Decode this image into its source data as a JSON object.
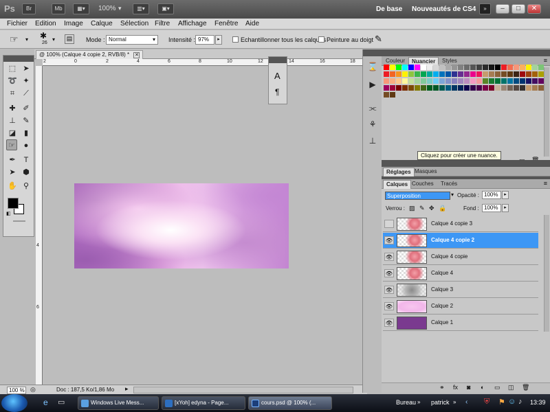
{
  "titlebar": {
    "app_logo": "Ps",
    "btn_br": "Br",
    "btn_mb": "Mb",
    "zoom": "100%",
    "workspace_basic": "De base",
    "workspace_cs4": "Nouveautés de CS4"
  },
  "menu": [
    "Fichier",
    "Edition",
    "Image",
    "Calque",
    "Sélection",
    "Filtre",
    "Affichage",
    "Fenêtre",
    "Aide"
  ],
  "options": {
    "brush_size": "26",
    "mode_label": "Mode :",
    "mode_value": "Normal",
    "intensity_label": "Intensité :",
    "intensity_value": "97%",
    "sample_all_label": "Echantillonner tous les calques",
    "finger_paint_label": "Peinture au doigt"
  },
  "document": {
    "tab_title": "@ 100% (Calque 4 copie 2, RVB/8) *",
    "ruler_top": [
      "2",
      "0",
      "2",
      "4",
      "6",
      "8",
      "10",
      "12",
      "14",
      "16",
      "18"
    ],
    "ruler_left": [
      "4",
      "6"
    ],
    "zoom_status": "100 %",
    "doc_status": "Doc : 187,5 Ko/1,86 Mo"
  },
  "panels": {
    "color_tabs": [
      "Couleur",
      "Nuancier",
      "Styles"
    ],
    "active_color_tab": "Nuancier",
    "tooltip": "Cliquez pour créer une nuance.",
    "adjust_tabs": [
      "Réglages",
      "Masques"
    ],
    "layer_tabs": [
      "Calques",
      "Couches",
      "Tracés"
    ],
    "blend_mode": "Superposition",
    "opacity_label": "Opacité :",
    "opacity_value": "100%",
    "lock_label": "Verrou :",
    "fill_label": "Fond :",
    "fill_value": "100%"
  },
  "layers": [
    {
      "name": "Calque 4 copie 3",
      "visible": false,
      "selected": false,
      "thumb": "flower"
    },
    {
      "name": "Calque 4 copie 2",
      "visible": true,
      "selected": true,
      "thumb": "flower"
    },
    {
      "name": "Calque 4  copie",
      "visible": true,
      "selected": false,
      "thumb": "flower"
    },
    {
      "name": "Calque 4",
      "visible": true,
      "selected": false,
      "thumb": "flower"
    },
    {
      "name": "Calque 3",
      "visible": true,
      "selected": false,
      "thumb": "gray"
    },
    {
      "name": "Calque 2",
      "visible": true,
      "selected": false,
      "thumb": "pink"
    },
    {
      "name": "Calque 1",
      "visible": true,
      "selected": false,
      "thumb": "purple"
    }
  ],
  "taskbar": {
    "tasks": [
      "Windows Live Mess...",
      "[xYoh] edyna - Page...",
      "cours.psd @ 100% (..."
    ],
    "active_task_index": 2,
    "bureau_label": "Bureau",
    "user": "patrick",
    "clock": "13:39"
  },
  "colors": {
    "selected_layer": "#3d97f5",
    "purple_layer": "#7a3a8f",
    "foreground": "#000000",
    "background": "#ffffff"
  },
  "swatch_rows": [
    [
      "#ff0000",
      "#ffff00",
      "#00ff00",
      "#00ffff",
      "#0000ff",
      "#ff00ff",
      "#ffffff",
      "#eeeeee",
      "#d6d6d6",
      "#c0c0c0",
      "#aaaaaa",
      "#959595",
      "#808080",
      "#6b6b6b",
      "#555555",
      "#404040",
      "#2b2b2b",
      "#151515",
      "#000000",
      "#ee1d24",
      "#f26c4f",
      "#f69679",
      "#fbaf5d",
      "#fff200",
      "#a3d39c",
      "#7cc576"
    ],
    [
      "#ed1c24",
      "#f26522",
      "#f7941d",
      "#fff200",
      "#8dc63f",
      "#39b54a",
      "#00a651",
      "#00a99d",
      "#00aeef",
      "#0072bc",
      "#0054a6",
      "#2e3192",
      "#662d91",
      "#92278f",
      "#ec008c",
      "#ed145b",
      "#c69c6d",
      "#a67c52",
      "#8c6239",
      "#754c24",
      "#603913",
      "#3c2415",
      "#9e0b0f",
      "#a0410d",
      "#a3620a",
      "#aba000"
    ],
    [
      "#f7977a",
      "#f9ad81",
      "#fdc68a",
      "#fff79a",
      "#c4df9b",
      "#a3d39c",
      "#82ca9d",
      "#7bcdc8",
      "#6ecff6",
      "#7ea7d8",
      "#8493ca",
      "#8882be",
      "#a187be",
      "#bc8dbf",
      "#f49ac2",
      "#f6989d",
      "#598527",
      "#197b30",
      "#007236",
      "#00746b",
      "#0076a3",
      "#004a80",
      "#003471",
      "#1b1464",
      "#440e62",
      "#630460"
    ],
    [
      "#9e005d",
      "#9e0039",
      "#790000",
      "#7b2e00",
      "#7d4900",
      "#827b00",
      "#406618",
      "#005e20",
      "#005826",
      "#005952",
      "#005b7f",
      "#003663",
      "#002157",
      "#0d004c",
      "#32004b",
      "#4b0049",
      "#7b0046",
      "#7a0026",
      "#c7b299",
      "#998675",
      "#736357",
      "#534741",
      "#362f2d",
      "#c69c6d",
      "#a67c52",
      "#8c6239"
    ],
    [
      "#754c24",
      "#603913"
    ]
  ]
}
